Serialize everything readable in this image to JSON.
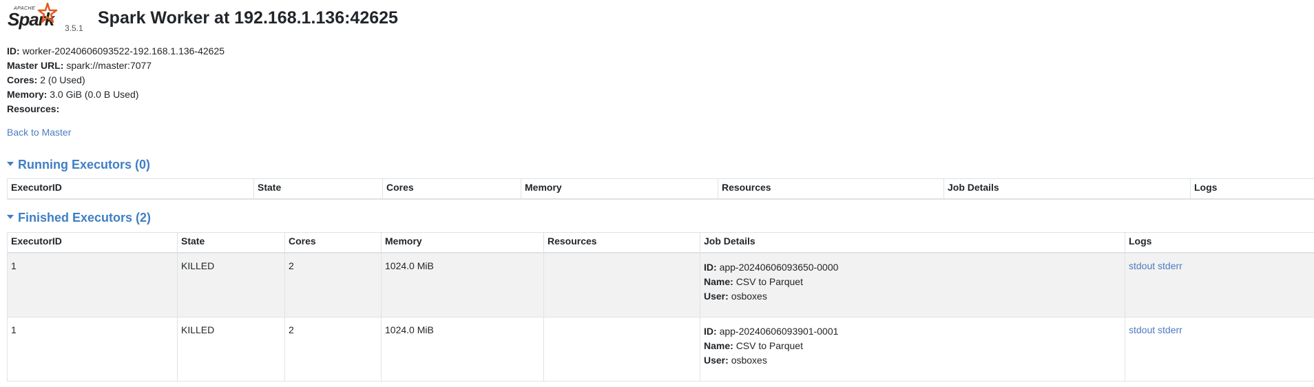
{
  "header": {
    "logo_top": "APACHE",
    "logo_main": "Spark",
    "version": "3.5.1",
    "title": "Spark Worker at 192.168.1.136:42625"
  },
  "info": {
    "id_label": "ID:",
    "id_value": "worker-20240606093522-192.168.1.136-42625",
    "master_label": "Master URL:",
    "master_value": "spark://master:7077",
    "cores_label": "Cores:",
    "cores_value": "2 (0 Used)",
    "memory_label": "Memory:",
    "memory_value": "3.0 GiB (0.0 B Used)",
    "resources_label": "Resources:",
    "resources_value": ""
  },
  "back_link": "Back to Master",
  "running": {
    "heading": "Running Executors (0)",
    "columns": [
      "ExecutorID",
      "State",
      "Cores",
      "Memory",
      "Resources",
      "Job Details",
      "Logs"
    ]
  },
  "finished": {
    "heading": "Finished Executors (2)",
    "columns": [
      "ExecutorID",
      "State",
      "Cores",
      "Memory",
      "Resources",
      "Job Details",
      "Logs"
    ],
    "rows": [
      {
        "executor_id": "1",
        "state": "KILLED",
        "cores": "2",
        "memory": "1024.0 MiB",
        "resources": "",
        "job_id_label": "ID:",
        "job_id": "app-20240606093650-0000",
        "job_name_label": "Name:",
        "job_name": "CSV to Parquet",
        "job_user_label": "User:",
        "job_user": "osboxes",
        "stdout": "stdout",
        "stderr": "stderr"
      },
      {
        "executor_id": "1",
        "state": "KILLED",
        "cores": "2",
        "memory": "1024.0 MiB",
        "resources": "",
        "job_id_label": "ID:",
        "job_id": "app-20240606093901-0001",
        "job_name_label": "Name:",
        "job_name": "CSV to Parquet",
        "job_user_label": "User:",
        "job_user": "osboxes",
        "stdout": "stdout",
        "stderr": "stderr"
      }
    ]
  },
  "colors": {
    "link": "#4d7bc1",
    "heading": "#3f7fc4",
    "star": "#e25a1c",
    "row_alt": "#f2f2f2"
  }
}
